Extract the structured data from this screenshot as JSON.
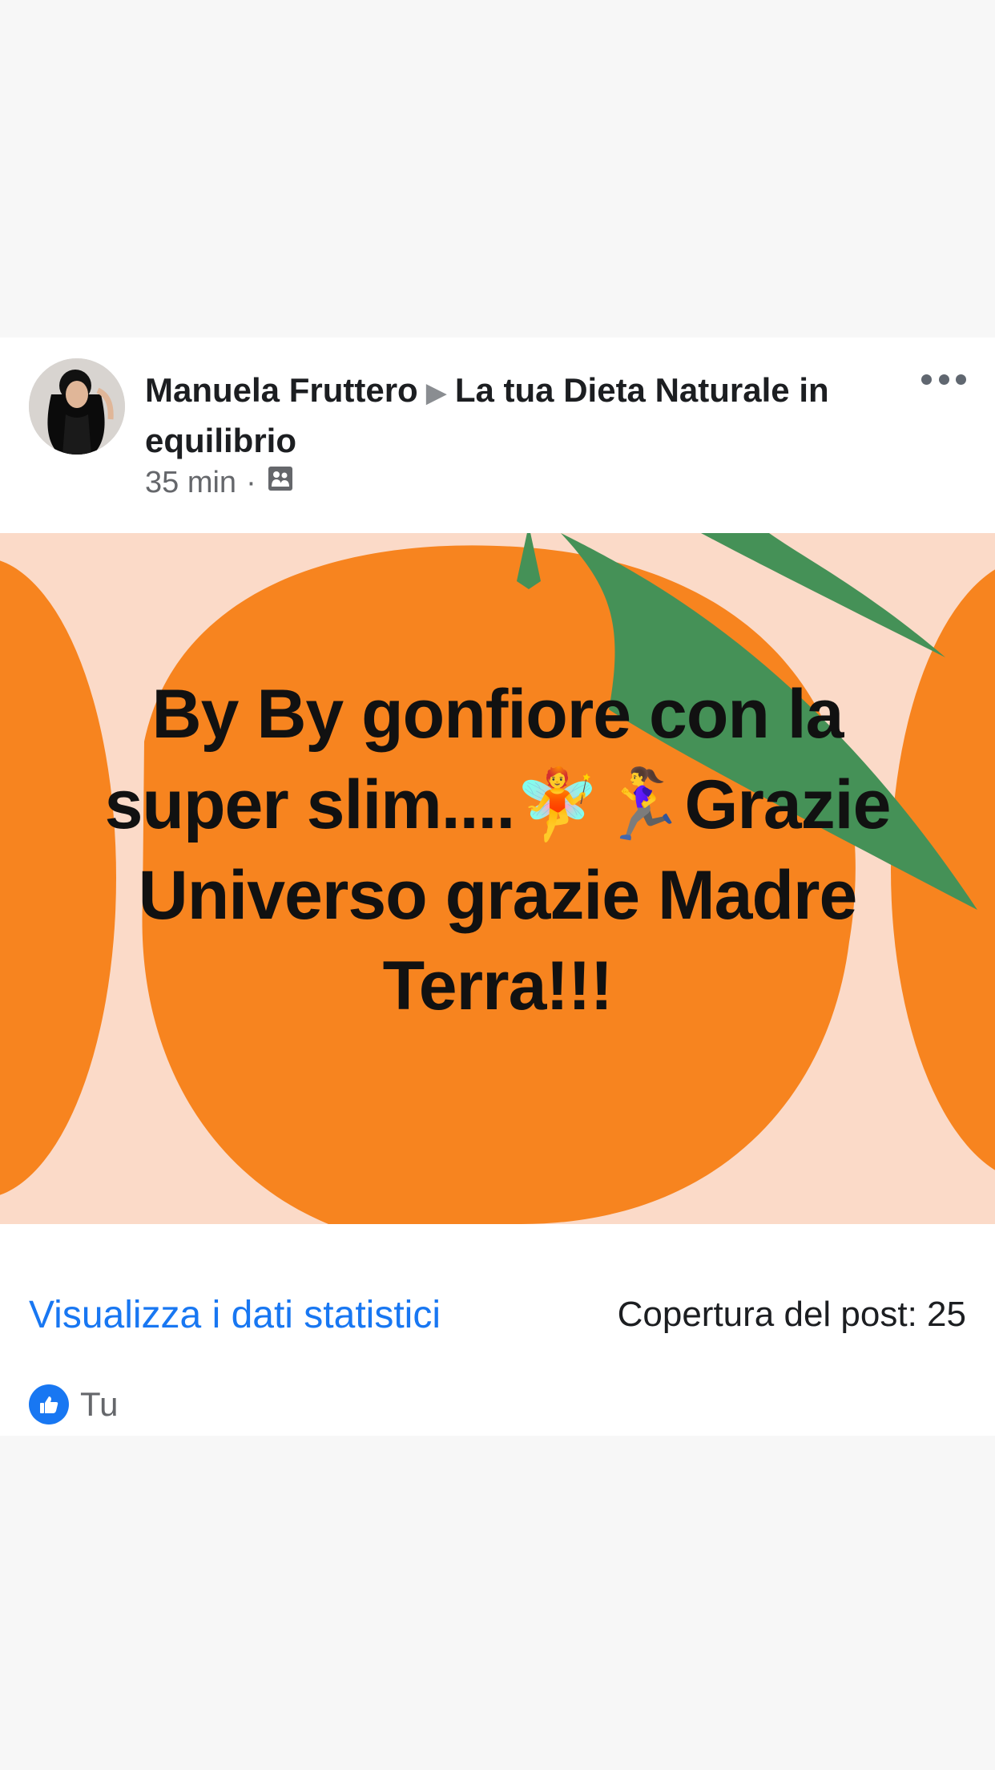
{
  "post": {
    "author": "Manuela Fruttero",
    "group": "La tua Dieta Naturale in equilibrio",
    "time": "35 min",
    "separator": "·",
    "privacy_icon": "group-members-icon",
    "more_icon": "more-options-icon",
    "image_text": "By By gonfiore con la super slim....🧚🏃‍♀️Grazie Universo grazie Madre Terra!!!"
  },
  "stats": {
    "link_label": "Visualizza i dati statistici",
    "reach_label": "Copertura del post: 25"
  },
  "reactions": {
    "icon": "like-icon",
    "label": "Tu"
  },
  "colors": {
    "accent": "#1877f2",
    "orange": "#f7841f",
    "background_peach": "#fbdac8",
    "leaf_green": "#459157"
  }
}
